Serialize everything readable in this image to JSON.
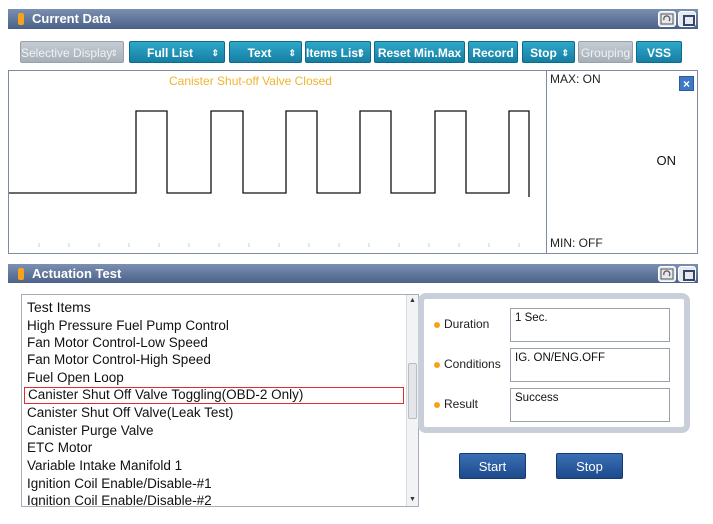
{
  "current_data": {
    "title": "Current Data",
    "toolbar": {
      "selective_display": "Selective Display",
      "full_list": "Full List",
      "text": "Text",
      "items_list": "Items List",
      "reset_min_max": "Reset Min.Max",
      "record": "Record",
      "stop": "Stop",
      "grouping": "Grouping",
      "vss": "VSS"
    },
    "graph": {
      "signal_name": "Canister Shut-off Valve Closed",
      "max_label": "MAX: ON",
      "min_label": "MIN: OFF",
      "current_value": "ON",
      "close_symbol": "×"
    }
  },
  "actuation_test": {
    "title": "Actuation Test",
    "list_header": "Test Items",
    "items": [
      "High Pressure Fuel Pump Control",
      "Fan Motor Control-Low Speed",
      "Fan Motor Control-High Speed",
      "Fuel Open Loop",
      "Canister Shut Off Valve Toggling(OBD-2 Only)",
      "Canister Shut Off Valve(Leak Test)",
      "Canister Purge Valve",
      "ETC Motor",
      "Variable Intake Manifold 1",
      "Ignition Coil Enable/Disable-#1",
      "Ignition Coil Enable/Disable-#2"
    ],
    "selected_index": 4,
    "info": {
      "duration_label": "Duration",
      "duration_value": "1 Sec.",
      "conditions_label": "Conditions",
      "conditions_value": "IG. ON/ENG.OFF",
      "result_label": "Result",
      "result_value": "Success"
    },
    "start_label": "Start",
    "stop_label": "Stop"
  },
  "colors": {
    "header_bg": "#4a5f86",
    "toolbar_button": "#1f93b8",
    "signal_label": "#f0b42d",
    "selection_border": "#e52a2a",
    "action_button": "#2a5ca0"
  }
}
